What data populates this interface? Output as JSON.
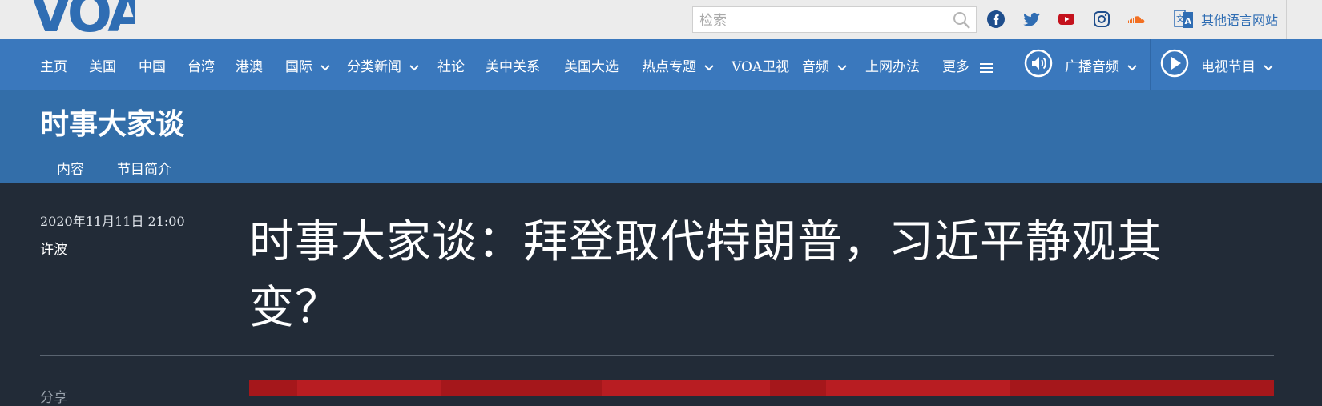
{
  "brand": {
    "logo_text": "VOA"
  },
  "search": {
    "placeholder": "检索"
  },
  "social": [
    "facebook-icon",
    "twitter-icon",
    "youtube-icon",
    "instagram-icon",
    "soundcloud-icon"
  ],
  "language_link": {
    "label": "其他语言网站"
  },
  "nav": {
    "items": [
      {
        "label": "主页"
      },
      {
        "label": "美国"
      },
      {
        "label": "中国"
      },
      {
        "label": "台湾"
      },
      {
        "label": "港澳"
      },
      {
        "label": "国际"
      },
      {
        "label": "分类新闻"
      },
      {
        "label": "社论"
      },
      {
        "label": "美中关系"
      },
      {
        "label": "美国大选"
      },
      {
        "label": "热点专题"
      },
      {
        "label": "VOA卫视"
      },
      {
        "label": "音频"
      },
      {
        "label": "上网办法"
      },
      {
        "label": "更多"
      }
    ],
    "radio_label": "广播音频",
    "tv_label": "电视节目"
  },
  "program": {
    "title": "时事大家谈",
    "tabs": [
      {
        "label": "内容"
      },
      {
        "label": "节目简介"
      }
    ]
  },
  "article": {
    "datetime": "2020年11月11日 21:00",
    "author": "许波",
    "headline": "时事大家谈：拜登取代特朗普，习近平静观其变？",
    "share_label": "分享"
  },
  "colors": {
    "nav_blue": "#3a78bd",
    "subhead_blue": "#336ea9",
    "dark_bg": "#222b37",
    "logo_blue": "#2f6db3"
  }
}
